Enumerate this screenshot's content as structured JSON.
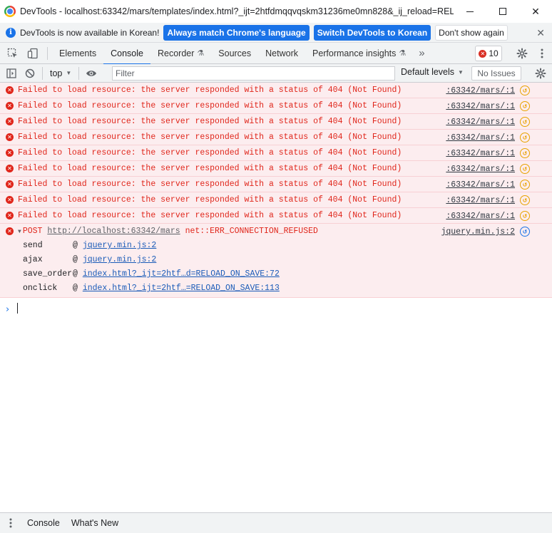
{
  "window": {
    "title": "DevTools - localhost:63342/mars/templates/index.html?_ijt=2htfdmqqvqskm31236me0mn828&_ij_reload=REL..."
  },
  "infobar": {
    "text": "DevTools is now available in Korean!",
    "btn_match": "Always match Chrome's language",
    "btn_switch": "Switch DevTools to Korean",
    "btn_dismiss": "Don't show again"
  },
  "tabs": {
    "elements": "Elements",
    "console": "Console",
    "recorder": "Recorder",
    "sources": "Sources",
    "network": "Network",
    "performance": "Performance insights",
    "error_count": "10"
  },
  "toolbar": {
    "context": "top",
    "filter_placeholder": "Filter",
    "levels": "Default levels",
    "issues": "No Issues"
  },
  "messages": [
    {
      "text": "Failed to load resource: the server responded with a status of 404 (Not Found)",
      "source": ":63342/mars/:1"
    },
    {
      "text": "Failed to load resource: the server responded with a status of 404 (Not Found)",
      "source": ":63342/mars/:1"
    },
    {
      "text": "Failed to load resource: the server responded with a status of 404 (Not Found)",
      "source": ":63342/mars/:1"
    },
    {
      "text": "Failed to load resource: the server responded with a status of 404 (Not Found)",
      "source": ":63342/mars/:1"
    },
    {
      "text": "Failed to load resource: the server responded with a status of 404 (Not Found)",
      "source": ":63342/mars/:1"
    },
    {
      "text": "Failed to load resource: the server responded with a status of 404 (Not Found)",
      "source": ":63342/mars/:1"
    },
    {
      "text": "Failed to load resource: the server responded with a status of 404 (Not Found)",
      "source": ":63342/mars/:1"
    },
    {
      "text": "Failed to load resource: the server responded with a status of 404 (Not Found)",
      "source": ":63342/mars/:1"
    },
    {
      "text": "Failed to load resource: the server responded with a status of 404 (Not Found)",
      "source": ":63342/mars/:1"
    }
  ],
  "post_error": {
    "method": "POST",
    "url": "http://localhost:63342/mars",
    "error": "net::ERR_CONNECTION_REFUSED",
    "source": "jquery.min.js:2",
    "stack": [
      {
        "fn": "send",
        "link": "jquery.min.js:2"
      },
      {
        "fn": "ajax",
        "link": "jquery.min.js:2"
      },
      {
        "fn": "save_order",
        "link": "index.html?_ijt=2htf…d=RELOAD_ON_SAVE:72"
      },
      {
        "fn": "onclick",
        "link": "index.html?_ijt=2htf…=RELOAD_ON_SAVE:113"
      }
    ]
  },
  "drawer": {
    "console": "Console",
    "whats_new": "What's New"
  },
  "colors": {
    "error_text": "#e0261b",
    "error_bg": "#fcedef",
    "accent": "#1a73e8"
  }
}
